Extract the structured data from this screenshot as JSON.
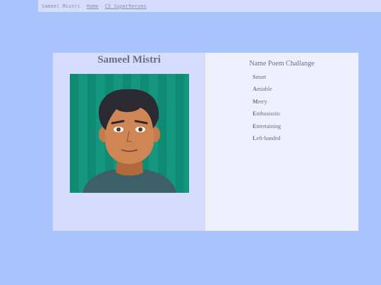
{
  "nav": {
    "site_name": "Sameel Mistri",
    "links": [
      "Home",
      "CS Superheroes"
    ]
  },
  "profile": {
    "name": "Sameel Mistri",
    "avatar_icon": "cartoon-avatar"
  },
  "poem": {
    "title": "Name Poem Challange",
    "lines": [
      {
        "first": "S",
        "rest": "mart"
      },
      {
        "first": "A",
        "rest": "miable"
      },
      {
        "first": "M",
        "rest": "erry"
      },
      {
        "first": "E",
        "rest": "nthusiastic"
      },
      {
        "first": "E",
        "rest": "ntertaining"
      },
      {
        "first": "L",
        "rest": "eft-handed"
      }
    ]
  },
  "colors": {
    "page_bg": "#a9c4fd",
    "nav_bg": "#d6ddfc",
    "left_panel": "#d5dcfc",
    "right_panel": "#eef0fd",
    "avatar_bg": "#14967f"
  }
}
